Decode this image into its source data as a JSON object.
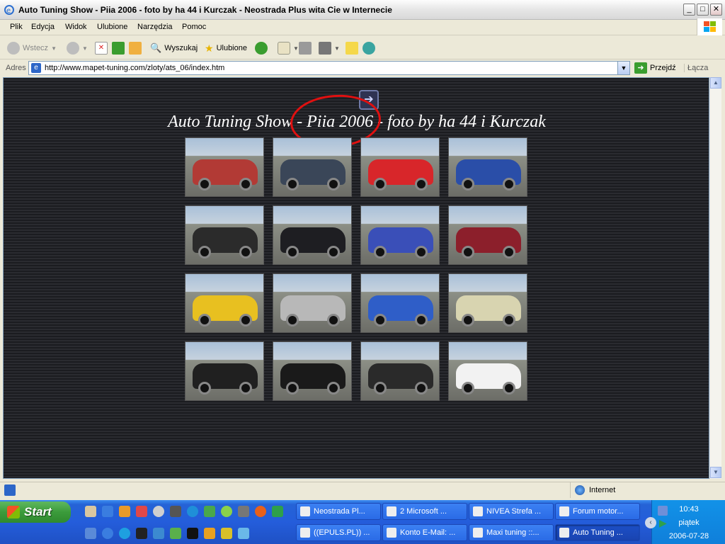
{
  "window": {
    "title": "Auto Tuning Show - Piia 2006 - foto by ha 44 i Kurczak - Neostrada Plus wita Cie w Internecie",
    "controls": {
      "minimize": "_",
      "maximize": "□",
      "close": "✕"
    }
  },
  "menu": [
    "Plik",
    "Edycja",
    "Widok",
    "Ulubione",
    "Narzędzia",
    "Pomoc"
  ],
  "toolbar": {
    "back": "Wstecz",
    "search": "Wyszukaj",
    "favorites": "Ulubione"
  },
  "address": {
    "label": "Adres",
    "url": "http://www.mapet-tuning.com/zloty/ats_06/index.htm",
    "go": "Przejdź",
    "links": "Łącza"
  },
  "page": {
    "title": "Auto Tuning Show - Piia 2006 - foto by ha 44 i Kurczak",
    "thumbnails": [
      {
        "color": "#b23a35"
      },
      {
        "color": "#3a4658"
      },
      {
        "color": "#d8262a"
      },
      {
        "color": "#2a4ea8"
      },
      {
        "color": "#2b2b2b"
      },
      {
        "color": "#1e1e22"
      },
      {
        "color": "#3a4fb8"
      },
      {
        "color": "#8c1f2b"
      },
      {
        "color": "#e8c020"
      },
      {
        "color": "#b8b8b8"
      },
      {
        "color": "#2f5ec8"
      },
      {
        "color": "#d8d4b0"
      },
      {
        "color": "#202020"
      },
      {
        "color": "#1a1a1a"
      },
      {
        "color": "#2a2a2a"
      },
      {
        "color": "#f2f2f2"
      }
    ]
  },
  "status": {
    "zone": "Internet"
  },
  "taskbar": {
    "start": "Start",
    "tasks": [
      "Neostrada Pl...",
      "2 Microsoft ...",
      "NIVEA Strefa ...",
      "Forum motor...",
      "((EPULS.PL)) ...",
      "Konto E-Mail: ...",
      "Maxi tuning ::...",
      "Auto Tuning ..."
    ],
    "clock": {
      "time": "10:43",
      "day": "piątek",
      "date": "2006-07-28"
    }
  }
}
